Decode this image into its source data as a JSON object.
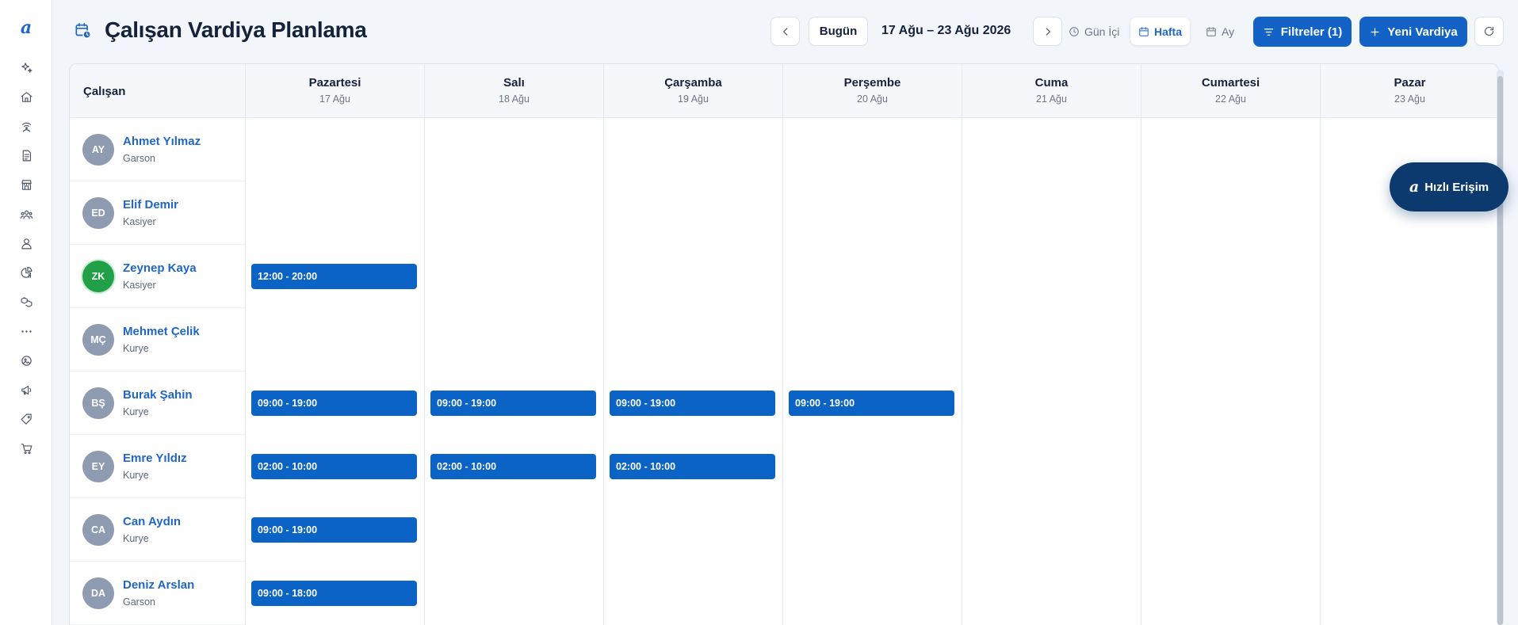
{
  "app": {
    "logo_glyph": "a"
  },
  "sidebar": {
    "icons": [
      "sparkles-icon",
      "home-icon",
      "wifi-hand-icon",
      "document-list-icon",
      "store-icon",
      "team-icon",
      "user-icon",
      "chart-pie-icon",
      "boxes-icon",
      "more-dots-icon",
      "image-circle-icon",
      "megaphone-icon",
      "tag-icon",
      "cart-icon"
    ]
  },
  "header": {
    "title": "Çalışan Vardiya Planlama",
    "today_label": "Bugün",
    "date_range": "17 Ağu – 23 Ağu 2026",
    "views": {
      "day": "Gün İçi",
      "week": "Hafta",
      "month": "Ay"
    },
    "active_view": "week",
    "filters_label": "Filtreler (1)",
    "new_shift_label": "Yeni Vardiya"
  },
  "calendar": {
    "employee_header": "Çalışan",
    "days": [
      {
        "name": "Pazartesi",
        "date": "17 Ağu"
      },
      {
        "name": "Salı",
        "date": "18 Ağu"
      },
      {
        "name": "Çarşamba",
        "date": "19 Ağu"
      },
      {
        "name": "Perşembe",
        "date": "20 Ağu"
      },
      {
        "name": "Cuma",
        "date": "21 Ağu"
      },
      {
        "name": "Cumartesi",
        "date": "22 Ağu"
      },
      {
        "name": "Pazar",
        "date": "23 Ağu"
      }
    ],
    "employees": [
      {
        "initials": "AY",
        "name": "Ahmet Yılmaz",
        "role": "Garson",
        "shifts": []
      },
      {
        "initials": "ED",
        "name": "Elif Demir",
        "role": "Kasiyer",
        "shifts": []
      },
      {
        "initials": "ZK",
        "name": "Zeynep Kaya",
        "role": "Kasiyer",
        "avatar_color": "#21a048",
        "shifts": [
          {
            "day": 0,
            "label": "12:00 - 20:00"
          }
        ]
      },
      {
        "initials": "MÇ",
        "name": "Mehmet Çelik",
        "role": "Kurye",
        "shifts": []
      },
      {
        "initials": "BŞ",
        "name": "Burak Şahin",
        "role": "Kurye",
        "shifts": [
          {
            "day": 0,
            "label": "09:00 - 19:00"
          },
          {
            "day": 1,
            "label": "09:00 - 19:00"
          },
          {
            "day": 2,
            "label": "09:00 - 19:00"
          },
          {
            "day": 3,
            "label": "09:00 - 19:00"
          }
        ]
      },
      {
        "initials": "EY",
        "name": "Emre Yıldız",
        "role": "Kurye",
        "shifts": [
          {
            "day": 0,
            "label": "02:00 - 10:00"
          },
          {
            "day": 1,
            "label": "02:00 - 10:00"
          },
          {
            "day": 2,
            "label": "02:00 - 10:00"
          }
        ]
      },
      {
        "initials": "CA",
        "name": "Can Aydın",
        "role": "Kurye",
        "shifts": [
          {
            "day": 0,
            "label": "09:00 - 19:00"
          }
        ]
      },
      {
        "initials": "DA",
        "name": "Deniz Arslan",
        "role": "Garson",
        "shifts": [
          {
            "day": 0,
            "label": "09:00 - 18:00"
          }
        ]
      }
    ]
  },
  "quick_access": {
    "logo_glyph": "a",
    "label": "Hızlı Erişim"
  },
  "colors": {
    "accent": "#1363c6",
    "shift": "#0b64c5",
    "quick_access": "#0d3a6e"
  }
}
